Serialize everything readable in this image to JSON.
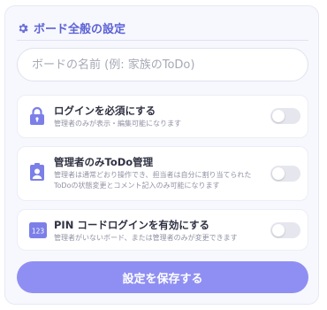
{
  "header": {
    "title": "ボード全般の設定",
    "icon": "gear-icon"
  },
  "board_name": {
    "placeholder": "ボードの名前 (例: 家族のToDo)",
    "value": ""
  },
  "settings": [
    {
      "label": "ログインを必須にする",
      "desc1": "管理者のみが表示・編集可能になります",
      "desc2": "",
      "icon": "lock-icon",
      "enabled": false
    },
    {
      "label": "管理者のみToDo管理",
      "desc1": "管理者は通常どおり操作でき、担当者は自分に割り当てられた",
      "desc2": "ToDoの状態変更とコメント記入のみ可能になります",
      "icon": "user-badge-icon",
      "enabled": false
    },
    {
      "label": "PIN コードログインを有効にする",
      "desc1": "管理者がいないボード、または管理者のみが変更できます",
      "desc2": "",
      "icon": "pin-123-icon",
      "icon_text": "123",
      "enabled": false
    }
  ],
  "save_button": {
    "label": "設定を保存する"
  },
  "colors": {
    "accent": "#5c62d6",
    "icon": "#7c7fe8",
    "button": "#8f8ff3",
    "toggle_off": "#e6e7ee"
  }
}
